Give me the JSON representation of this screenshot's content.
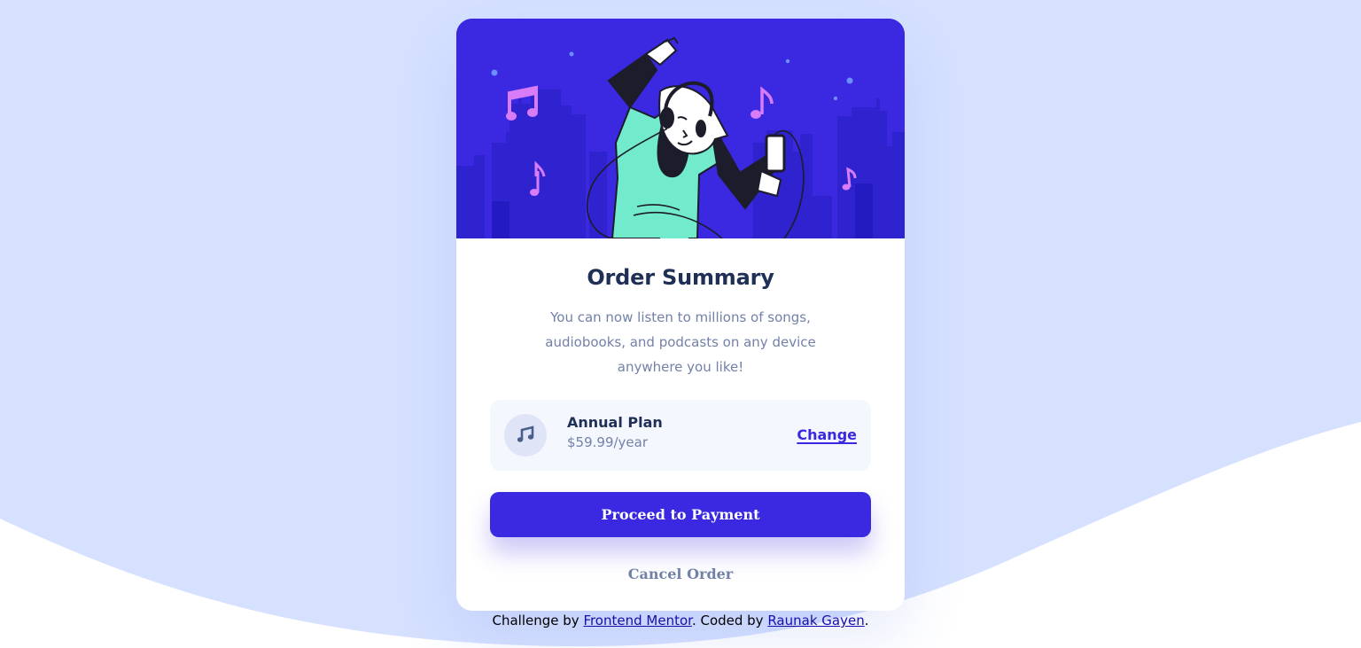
{
  "page": {
    "background_color": "#d6e1ff",
    "wave_color": "#ffffff"
  },
  "card": {
    "hero_illustration": "person-dancing-with-headphones-city-illustration",
    "hero_background": "#3a29e0",
    "title": "Order Summary",
    "description": "You can now listen to millions of songs, audiobooks, and podcasts on any device anywhere you like!",
    "plan": {
      "icon": "music-note-icon",
      "name": "Annual Plan",
      "price": "$59.99/year",
      "change_label": "Change"
    },
    "primary_button_label": "Proceed to Payment",
    "secondary_button_label": "Cancel Order",
    "accent_color": "#3a29e0",
    "heading_color": "#1f2f56",
    "muted_color": "#7281a8"
  },
  "attribution": {
    "prefix": "Challenge by ",
    "link1_text": "Frontend Mentor",
    "middle": ". Coded by ",
    "link2_text": "Raunak Gayen",
    "suffix": "."
  }
}
